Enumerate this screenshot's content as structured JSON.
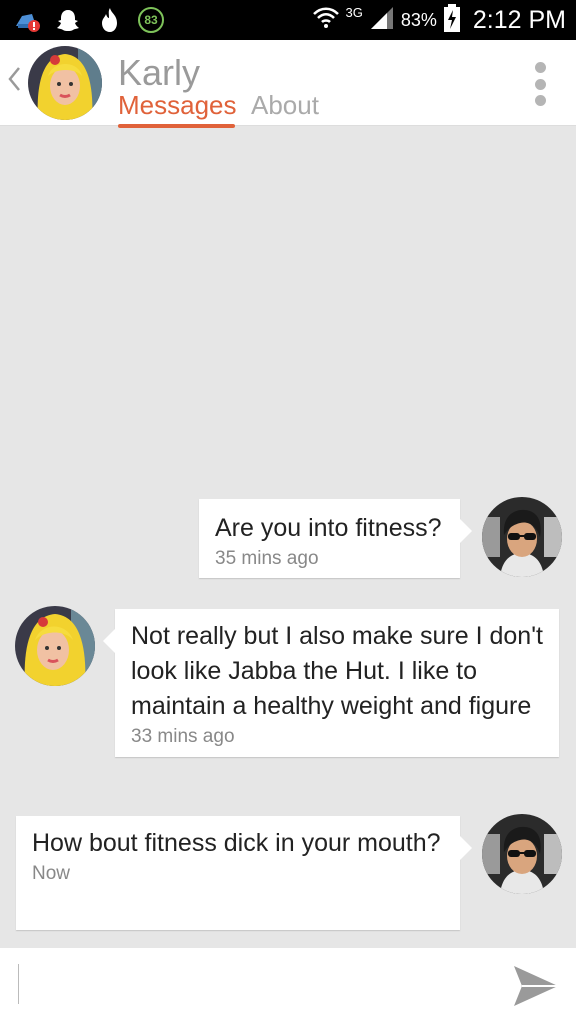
{
  "status_bar": {
    "notification_badge": "83",
    "network": "3G",
    "battery": "83%",
    "time": "2:12 PM"
  },
  "header": {
    "contact_name": "Karly",
    "tabs": [
      {
        "label": "Messages",
        "active": true
      },
      {
        "label": "About",
        "active": false
      }
    ]
  },
  "messages": [
    {
      "sender": "me",
      "text": "Are you into fitness?",
      "time": "35 mins ago"
    },
    {
      "sender": "them",
      "text": "Not really but I also make sure I don't look like Jabba the Hut. I like to maintain a healthy weight and figure",
      "time": "33 mins ago"
    },
    {
      "sender": "me",
      "text": "How bout fitness dick in your mouth?",
      "time": "Now"
    }
  ],
  "composer": {
    "value": "",
    "placeholder": ""
  },
  "colors": {
    "accent": "#e0623a",
    "background": "#e6e6e6",
    "status_bar": "#000000"
  },
  "icons": [
    "cleaner-warning-icon",
    "snapchat-ghost-icon",
    "tinder-flame-icon",
    "wifi-icon",
    "signal-icon",
    "battery-charging-icon",
    "back-chevron-icon",
    "more-vert-icon",
    "send-icon"
  ]
}
